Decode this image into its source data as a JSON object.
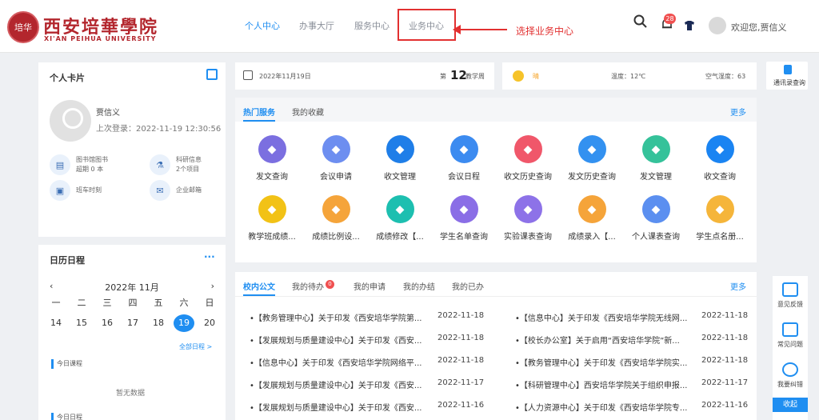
{
  "header": {
    "logo_text": "培华",
    "school_cn": "西安培華學院",
    "school_en": "XI'AN PEIHUA UNIVERSITY",
    "nav": [
      "个人中心",
      "办事大厅",
      "服务中心",
      "业务中心"
    ],
    "active_nav": "个人中心",
    "annotation": "选择业务中心",
    "notification_count": "28",
    "welcome": "欢迎您,贾信义",
    "icons": [
      "search-icon",
      "bell-icon",
      "shirt-icon",
      "user-avatar"
    ]
  },
  "profile": {
    "title": "个人卡片",
    "name": "贾信义",
    "last_login": "上次登录：2022-11-19 12:30:56",
    "items": [
      {
        "label": "图书馆图书",
        "sub": "超期 0 本",
        "icon": "book-icon"
      },
      {
        "label": "科研信息",
        "sub": "2个项目",
        "icon": "flask-icon"
      },
      {
        "label": "班车时刻",
        "sub": "",
        "icon": "bus-icon"
      },
      {
        "label": "企业邮箱",
        "sub": "",
        "icon": "mail-icon"
      }
    ]
  },
  "calendar": {
    "title": "日历日程",
    "month": "2022年 11月",
    "weekdays": [
      "一",
      "二",
      "三",
      "四",
      "五",
      "六",
      "日"
    ],
    "days": [
      "14",
      "15",
      "16",
      "17",
      "18",
      "19",
      "20"
    ],
    "today": "19",
    "all_schedule": "全部日程 >",
    "today_course": "今日课程",
    "no_data": "暂无数据",
    "today_schedule": "今日日程"
  },
  "datebar": {
    "date": "2022年11月19日",
    "week_prefix": "第",
    "week_num": "12",
    "week_suffix": "教学周"
  },
  "weather": {
    "condition": "晴",
    "temp": "温度：12℃",
    "air": "空气湿度：63"
  },
  "side_contacts": {
    "label": "通讯录查询"
  },
  "services": {
    "tabs": [
      "热门服务",
      "我的收藏"
    ],
    "more": "更多",
    "items": [
      {
        "label": "发文查询",
        "color": "#7b6fe0",
        "icon": "doc-icon"
      },
      {
        "label": "会议申请",
        "color": "#6d8ef0",
        "icon": "meeting-icon"
      },
      {
        "label": "收文管理",
        "color": "#1f7ee8",
        "icon": "org-icon"
      },
      {
        "label": "会议日程",
        "color": "#3c8bf0",
        "icon": "schedule-icon"
      },
      {
        "label": "收文历史查询",
        "color": "#f0576a",
        "icon": "history-icon"
      },
      {
        "label": "发文历史查询",
        "color": "#3391f0",
        "icon": "globe-icon"
      },
      {
        "label": "发文管理",
        "color": "#35c29a",
        "icon": "send-icon"
      },
      {
        "label": "收文查询",
        "color": "#1a84f2",
        "icon": "inbox-icon"
      },
      {
        "label": "教学班成绩...",
        "color": "#f2c216",
        "icon": "grade-icon"
      },
      {
        "label": "成绩比例设...",
        "color": "#f5a43a",
        "icon": "pencil-icon"
      },
      {
        "label": "成绩修改【...",
        "color": "#1dbfb0",
        "icon": "calendar-icon"
      },
      {
        "label": "学生名单查询",
        "color": "#8a6ee6",
        "icon": "list-icon"
      },
      {
        "label": "实验课表查询",
        "color": "#8d72e8",
        "icon": "lab-icon"
      },
      {
        "label": "成绩录入【...",
        "color": "#f5a43a",
        "icon": "teacher-icon"
      },
      {
        "label": "个人课表查询",
        "color": "#5b8ff0",
        "icon": "table-icon"
      },
      {
        "label": "学生点名册...",
        "color": "#f5b53a",
        "icon": "rollcall-icon"
      }
    ]
  },
  "notices": {
    "tabs": [
      "校内公文",
      "我的待办",
      "我的申请",
      "我的办结",
      "我的已办"
    ],
    "todo_count": "0",
    "more": "更多",
    "left": [
      {
        "title": "•【教务管理中心】关于印发《西安培华学院第...",
        "date": "2022-11-18"
      },
      {
        "title": "•【发展规划与质量建设中心】关于印发《西安...",
        "date": "2022-11-18"
      },
      {
        "title": "•【信息中心】关于印发《西安培华学院网络平...",
        "date": "2022-11-18"
      },
      {
        "title": "•【发展规划与质量建设中心】关于印发《西安...",
        "date": "2022-11-17"
      },
      {
        "title": "•【发展规划与质量建设中心】关于印发《西安...",
        "date": "2022-11-16"
      }
    ],
    "right": [
      {
        "title": "•【信息中心】关于印发《西安培华学院无线网...",
        "date": "2022-11-18"
      },
      {
        "title": "•【校长办公室】关于启用“西安培华学院”新...",
        "date": "2022-11-18"
      },
      {
        "title": "•【教务管理中心】关于印发《西安培华学院实...",
        "date": "2022-11-18"
      },
      {
        "title": "•【科研管理中心】西安培华学院关于组织申报...",
        "date": "2022-11-17"
      },
      {
        "title": "•【人力资源中心】关于印发《西安培华学院专...",
        "date": "2022-11-16"
      }
    ]
  },
  "floatbar": {
    "items": [
      "意见反馈",
      "常见问题",
      "我要纠错"
    ],
    "collapse": "收起"
  }
}
